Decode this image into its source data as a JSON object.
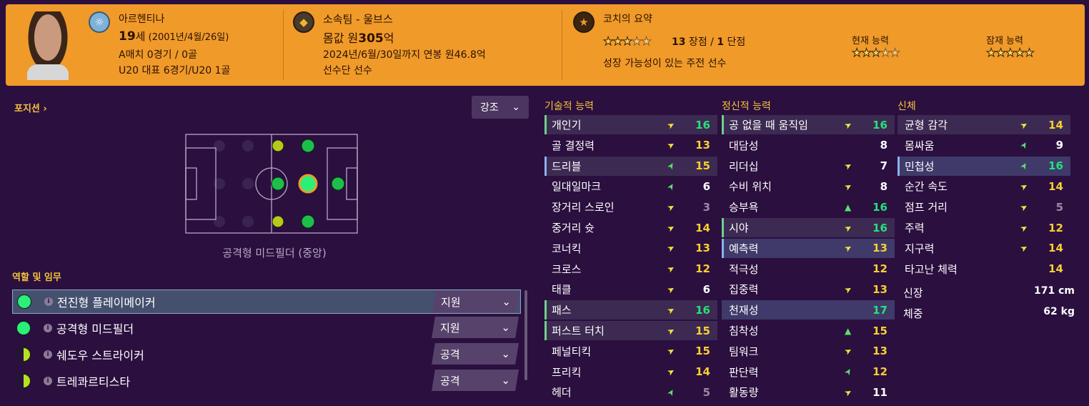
{
  "colors": {
    "accent": "#f09a2a",
    "background": "#2b0f3f",
    "high": "#26e07a",
    "good": "#f5d030",
    "low": "#9a8aa6"
  },
  "header": {
    "nationality": "아르헨티나",
    "age": "19",
    "age_suffix": "세",
    "birth": " (2001년/4월/26일)",
    "caps": "A매치 0경기 / 0골",
    "u20": "U20 대표 6경기/U20 1골",
    "club": "소속팀 - 울브스",
    "value_prefix": "몸값 원",
    "value": "305",
    "value_suffix": "억",
    "contract": "2024년/6월/30일까지 연봉 원46.8억",
    "squad": "선수단 선수",
    "coach_title": "코치의 요약",
    "coach_rating_stars": 2.5,
    "coach_count": "13",
    "coach_count_label": " 장점 / ",
    "coach_weak": "1",
    "coach_weak_label": " 단점",
    "coach_summary": "성장 가능성이 있는 주전 선수",
    "current_label": "현재 능력",
    "current_stars": 2.5,
    "potential_label": "잠재 능력",
    "potential_stars": 4.5
  },
  "left": {
    "position_title": "포지션",
    "emphasis_label": "강조",
    "position_name": "공격형 미드필더 (중앙)",
    "roles_title": "역할 및 임무",
    "roles": [
      {
        "name": "전진형 플레이메이커",
        "duty": "지원",
        "fit": "full"
      },
      {
        "name": "공격형 미드필더",
        "duty": "지원",
        "fit": "full"
      },
      {
        "name": "쉐도우 스트라이커",
        "duty": "공격",
        "fit": "half"
      },
      {
        "name": "트레콰르티스타",
        "duty": "공격",
        "fit": "half"
      }
    ]
  },
  "technical": {
    "title": "기술적 능력",
    "items": [
      {
        "name": "개인기",
        "value": "16",
        "trend": "up-right",
        "tier": "high",
        "mark": "green",
        "row": "hl"
      },
      {
        "name": "골 결정력",
        "value": "13",
        "trend": "up-right",
        "tier": "good",
        "mark": "",
        "row": ""
      },
      {
        "name": "드리블",
        "value": "15",
        "trend": "up",
        "tier": "good",
        "mark": "blue",
        "row": "hl"
      },
      {
        "name": "일대일마크",
        "value": "6",
        "trend": "up",
        "tier": "normal",
        "mark": "",
        "row": ""
      },
      {
        "name": "장거리 스로인",
        "value": "3",
        "trend": "up-right",
        "tier": "low",
        "mark": "",
        "row": ""
      },
      {
        "name": "중거리 슛",
        "value": "14",
        "trend": "up-right",
        "tier": "good",
        "mark": "",
        "row": ""
      },
      {
        "name": "코너킥",
        "value": "13",
        "trend": "up-right",
        "tier": "good",
        "mark": "",
        "row": ""
      },
      {
        "name": "크로스",
        "value": "12",
        "trend": "up-right",
        "tier": "good",
        "mark": "",
        "row": ""
      },
      {
        "name": "태클",
        "value": "6",
        "trend": "up-right",
        "tier": "normal",
        "mark": "",
        "row": ""
      },
      {
        "name": "패스",
        "value": "16",
        "trend": "up-right",
        "tier": "high",
        "mark": "green",
        "row": "hl"
      },
      {
        "name": "퍼스트 터치",
        "value": "15",
        "trend": "up-right",
        "tier": "good",
        "mark": "green",
        "row": "hl"
      },
      {
        "name": "페널티킥",
        "value": "15",
        "trend": "up-right",
        "tier": "good",
        "mark": "",
        "row": ""
      },
      {
        "name": "프리킥",
        "value": "14",
        "trend": "up-right",
        "tier": "good",
        "mark": "",
        "row": ""
      },
      {
        "name": "헤더",
        "value": "5",
        "trend": "up",
        "tier": "low",
        "mark": "",
        "row": ""
      }
    ]
  },
  "mental": {
    "title": "정신적 능력",
    "items": [
      {
        "name": "공 없을 때 움직임",
        "value": "16",
        "trend": "up-right",
        "tier": "high",
        "mark": "green",
        "row": "hl"
      },
      {
        "name": "대담성",
        "value": "8",
        "trend": "",
        "tier": "normal",
        "mark": "",
        "row": ""
      },
      {
        "name": "리더십",
        "value": "7",
        "trend": "up-right",
        "tier": "normal",
        "mark": "",
        "row": ""
      },
      {
        "name": "수비 위치",
        "value": "8",
        "trend": "up-right",
        "tier": "normal",
        "mark": "",
        "row": ""
      },
      {
        "name": "승부욕",
        "value": "16",
        "trend": "up2",
        "tier": "high",
        "mark": "",
        "row": ""
      },
      {
        "name": "시야",
        "value": "16",
        "trend": "up-right",
        "tier": "high",
        "mark": "green",
        "row": "hl"
      },
      {
        "name": "예측력",
        "value": "13",
        "trend": "up-right",
        "tier": "good",
        "mark": "blue",
        "row": "sel"
      },
      {
        "name": "적극성",
        "value": "12",
        "trend": "",
        "tier": "good",
        "mark": "",
        "row": ""
      },
      {
        "name": "집중력",
        "value": "13",
        "trend": "up-right",
        "tier": "good",
        "mark": "",
        "row": ""
      },
      {
        "name": "천재성",
        "value": "17",
        "trend": "",
        "tier": "high",
        "mark": "",
        "row": "sel"
      },
      {
        "name": "침착성",
        "value": "15",
        "trend": "up2",
        "tier": "good",
        "mark": "",
        "row": ""
      },
      {
        "name": "팀워크",
        "value": "13",
        "trend": "up-right",
        "tier": "good",
        "mark": "",
        "row": ""
      },
      {
        "name": "판단력",
        "value": "12",
        "trend": "up",
        "tier": "good",
        "mark": "",
        "row": ""
      },
      {
        "name": "활동량",
        "value": "11",
        "trend": "up-right",
        "tier": "normal",
        "mark": "",
        "row": ""
      }
    ]
  },
  "physical": {
    "title": "신체",
    "items": [
      {
        "name": "균형 감각",
        "value": "14",
        "trend": "up-right",
        "tier": "good",
        "mark": "",
        "row": "hl"
      },
      {
        "name": "몸싸움",
        "value": "9",
        "trend": "up",
        "tier": "normal",
        "mark": "",
        "row": ""
      },
      {
        "name": "민첩성",
        "value": "16",
        "trend": "up",
        "tier": "high",
        "mark": "blue",
        "row": "sel"
      },
      {
        "name": "순간 속도",
        "value": "14",
        "trend": "up-right",
        "tier": "good",
        "mark": "",
        "row": ""
      },
      {
        "name": "점프 거리",
        "value": "5",
        "trend": "up-right",
        "tier": "low",
        "mark": "",
        "row": ""
      },
      {
        "name": "주력",
        "value": "12",
        "trend": "up-right",
        "tier": "good",
        "mark": "",
        "row": ""
      },
      {
        "name": "지구력",
        "value": "14",
        "trend": "up-right",
        "tier": "good",
        "mark": "",
        "row": ""
      },
      {
        "name": "타고난 체력",
        "value": "14",
        "trend": "",
        "tier": "good",
        "mark": "",
        "row": ""
      }
    ],
    "height_label": "신장",
    "height": "171 cm",
    "weight_label": "체중",
    "weight": "62 kg"
  }
}
